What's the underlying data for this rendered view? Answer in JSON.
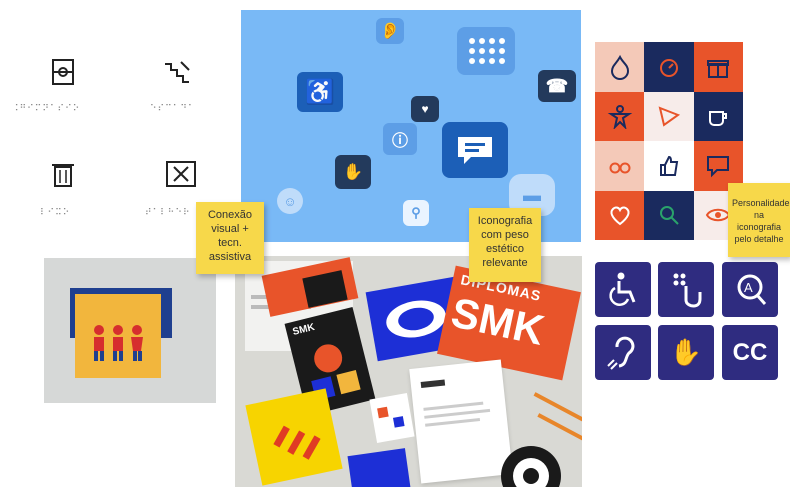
{
  "stickies": [
    "Conexão visual + tecn. assistiva",
    "Iconografia com peso estético relevante",
    "Personalidade na iconografia pelo detalhe"
  ],
  "braille_glyphs": [
    "⠨⠛⠊⠍⠝⠁⠎⠊⠕",
    "⠑⠎⠉⠁⠙⠁",
    "⠇⠊⠭⠕",
    "⠞⠁⠇⠓⠑⠗"
  ],
  "photo": {
    "brand_mark": "SMK",
    "poster_word": "DIPLOMAS"
  },
  "tiles": {
    "cc": "CC"
  },
  "colors": {
    "blue_canvas": "#79b9f6",
    "navy": "#1a2a5e",
    "orange": "#e8542a",
    "purple": "#2f2c80",
    "sticky": "#f7d84a"
  }
}
